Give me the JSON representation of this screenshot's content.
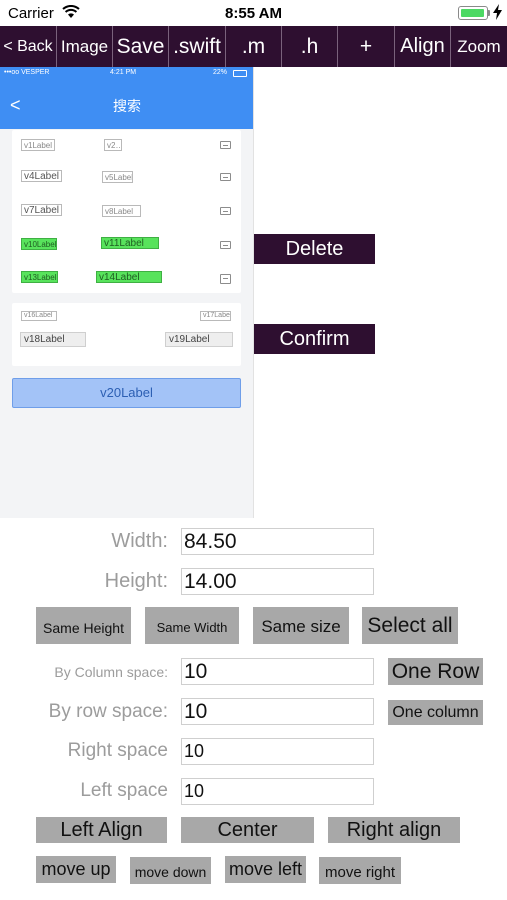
{
  "status_bar": {
    "carrier": "Carrier",
    "time": "8:55 AM"
  },
  "toolbar": [
    {
      "id": "back",
      "label": "< Back"
    },
    {
      "id": "image",
      "label": "Image"
    },
    {
      "id": "save",
      "label": "Save"
    },
    {
      "id": "swift",
      "label": ".swift"
    },
    {
      "id": "m",
      "label": ".m"
    },
    {
      "id": "h",
      "label": ".h"
    },
    {
      "id": "add",
      "label": "+"
    },
    {
      "id": "align",
      "label": "Align"
    },
    {
      "id": "zoom",
      "label": "Zoom"
    }
  ],
  "preview": {
    "status": {
      "carrier": "•••oo VESPER",
      "time": "4:21 PM",
      "battery": "22%"
    },
    "nav": {
      "back": "<",
      "title": "搜索"
    },
    "rows": [
      {
        "left": "v1Label",
        "right": "v2…"
      },
      {
        "left": "v4Label",
        "right": "v5Label"
      },
      {
        "left": "v7Label",
        "right": "v8Label"
      },
      {
        "left": "v10Label",
        "right": "v11Label"
      },
      {
        "left": "v13Label",
        "right": "v14Label"
      }
    ],
    "card2": {
      "top_left": "v16Label",
      "top_right": "v17Label",
      "bottom_left": "v18Label",
      "bottom_right": "v19Label"
    },
    "main_button": "v20Label"
  },
  "actions": {
    "delete": "Delete",
    "confirm": "Confirm"
  },
  "form": {
    "width_label": "Width:",
    "width_value": "84.50",
    "height_label": "Height:",
    "height_value": "14.00",
    "same_height": "Same Height",
    "same_width": "Same Width",
    "same_size": "Same size",
    "select_all": "Select all",
    "column_space_label": "By Column space:",
    "column_space_value": "10",
    "one_row": "One Row",
    "row_space_label": "By row space:",
    "row_space_value": "10",
    "one_column": "One column",
    "right_space_label": "Right space",
    "right_space_value": "10",
    "left_space_label": "Left space",
    "left_space_value": "10",
    "left_align": "Left Align",
    "center": "Center",
    "right_align": "Right align",
    "move_up": "move up",
    "move_down": "move down",
    "move_left": "move left",
    "move_right": "move right"
  },
  "colors": {
    "toolbar_bg": "#2e0f30",
    "preview_blue": "#3f8ef3",
    "label_green": "#58e35c",
    "button_gray": "#a8a8a8"
  }
}
